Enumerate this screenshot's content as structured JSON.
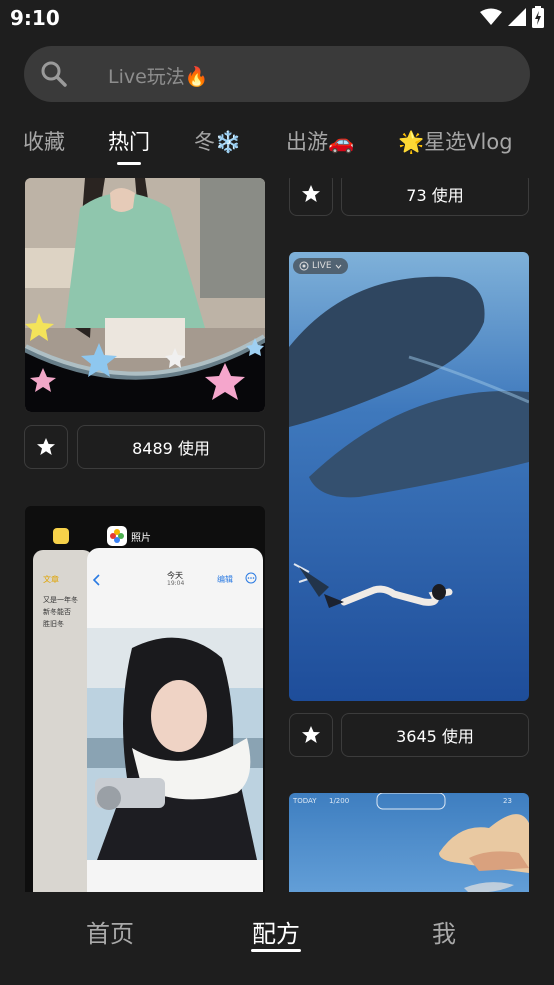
{
  "status_bar": {
    "time": "9:10"
  },
  "search": {
    "placeholder": "Live玩法🔥"
  },
  "tabs": [
    {
      "label": "收藏"
    },
    {
      "label": "热门"
    },
    {
      "label": "冬❄️"
    },
    {
      "label": "出游🚗"
    },
    {
      "label": "🌟星选Vlog"
    }
  ],
  "active_tab": "热门",
  "feed": {
    "cards": [
      {
        "id": "card-girl-stars",
        "use_label": "8489 使用"
      },
      {
        "id": "card-top-right",
        "use_label": "73 使用"
      },
      {
        "id": "card-whales",
        "live_label": "LIVE",
        "use_label": "3645 使用"
      },
      {
        "id": "card-photos",
        "app_label": "照片",
        "notes_back": "文章",
        "notes_text": [
          "又是一年冬",
          "新冬能否",
          "胜旧冬"
        ],
        "today_label": "今天",
        "today_time": "19:04",
        "edit_label": "编辑"
      },
      {
        "id": "card-sky",
        "top_left_text": "TODAY",
        "top_mid_text": "1/200",
        "top_right_text": "23"
      }
    ]
  },
  "bottom_nav": [
    {
      "label": "首页"
    },
    {
      "label": "配方"
    },
    {
      "label": "我"
    }
  ],
  "active_nav": "配方",
  "colors": {
    "background": "#1e1e1e",
    "search_bg": "#3a3a3a",
    "border": "#3c3c3c",
    "inactive_text": "#a6a6a6"
  }
}
